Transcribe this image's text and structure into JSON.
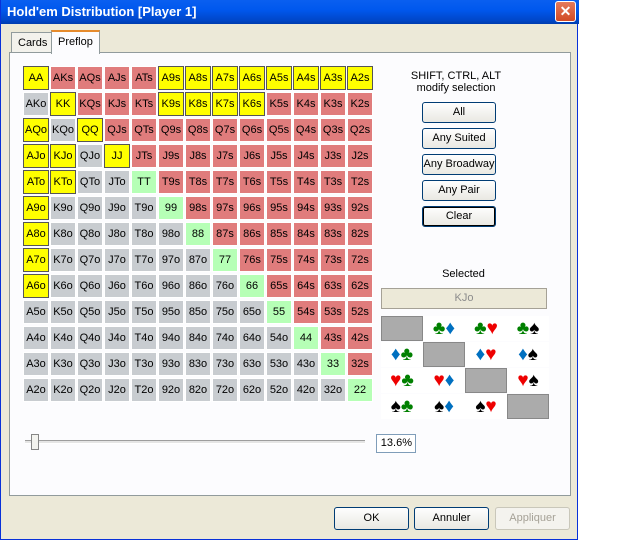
{
  "window": {
    "title": "Hold'em Distribution [Player 1]",
    "close_glyph": "✕"
  },
  "tabs": [
    {
      "label": "Cards"
    },
    {
      "label": "Preflop"
    }
  ],
  "hands": [
    [
      [
        "AA",
        "sel"
      ],
      [
        "AKs",
        "suited"
      ],
      [
        "AQs",
        "suited"
      ],
      [
        "AJs",
        "suited"
      ],
      [
        "ATs",
        "suited"
      ],
      [
        "A9s",
        "sel"
      ],
      [
        "A8s",
        "sel"
      ],
      [
        "A7s",
        "sel"
      ],
      [
        "A6s",
        "sel"
      ],
      [
        "A5s",
        "sel"
      ],
      [
        "A4s",
        "sel"
      ],
      [
        "A3s",
        "sel"
      ],
      [
        "A2s",
        "sel"
      ]
    ],
    [
      [
        "AKo",
        "offsuit"
      ],
      [
        "KK",
        "sel"
      ],
      [
        "KQs",
        "suited"
      ],
      [
        "KJs",
        "suited"
      ],
      [
        "KTs",
        "suited"
      ],
      [
        "K9s",
        "sel"
      ],
      [
        "K8s",
        "sel"
      ],
      [
        "K7s",
        "sel"
      ],
      [
        "K6s",
        "sel"
      ],
      [
        "K5s",
        "suited"
      ],
      [
        "K4s",
        "suited"
      ],
      [
        "K3s",
        "suited"
      ],
      [
        "K2s",
        "suited"
      ]
    ],
    [
      [
        "AQo",
        "sel"
      ],
      [
        "KQo",
        "offsuit"
      ],
      [
        "QQ",
        "sel"
      ],
      [
        "QJs",
        "suited"
      ],
      [
        "QTs",
        "suited"
      ],
      [
        "Q9s",
        "suited"
      ],
      [
        "Q8s",
        "suited"
      ],
      [
        "Q7s",
        "suited"
      ],
      [
        "Q6s",
        "suited"
      ],
      [
        "Q5s",
        "suited"
      ],
      [
        "Q4s",
        "suited"
      ],
      [
        "Q3s",
        "suited"
      ],
      [
        "Q2s",
        "suited"
      ]
    ],
    [
      [
        "AJo",
        "sel"
      ],
      [
        "KJo",
        "sel"
      ],
      [
        "QJo",
        "offsuit"
      ],
      [
        "JJ",
        "sel"
      ],
      [
        "JTs",
        "suited"
      ],
      [
        "J9s",
        "suited"
      ],
      [
        "J8s",
        "suited"
      ],
      [
        "J7s",
        "suited"
      ],
      [
        "J6s",
        "suited"
      ],
      [
        "J5s",
        "suited"
      ],
      [
        "J4s",
        "suited"
      ],
      [
        "J3s",
        "suited"
      ],
      [
        "J2s",
        "suited"
      ]
    ],
    [
      [
        "ATo",
        "sel"
      ],
      [
        "KTo",
        "sel"
      ],
      [
        "QTo",
        "offsuit"
      ],
      [
        "JTo",
        "offsuit"
      ],
      [
        "TT",
        "pair"
      ],
      [
        "T9s",
        "suited"
      ],
      [
        "T8s",
        "suited"
      ],
      [
        "T7s",
        "suited"
      ],
      [
        "T6s",
        "suited"
      ],
      [
        "T5s",
        "suited"
      ],
      [
        "T4s",
        "suited"
      ],
      [
        "T3s",
        "suited"
      ],
      [
        "T2s",
        "suited"
      ]
    ],
    [
      [
        "A9o",
        "sel"
      ],
      [
        "K9o",
        "offsuit"
      ],
      [
        "Q9o",
        "offsuit"
      ],
      [
        "J9o",
        "offsuit"
      ],
      [
        "T9o",
        "offsuit"
      ],
      [
        "99",
        "pair"
      ],
      [
        "98s",
        "suited"
      ],
      [
        "97s",
        "suited"
      ],
      [
        "96s",
        "suited"
      ],
      [
        "95s",
        "suited"
      ],
      [
        "94s",
        "suited"
      ],
      [
        "93s",
        "suited"
      ],
      [
        "92s",
        "suited"
      ]
    ],
    [
      [
        "A8o",
        "sel"
      ],
      [
        "K8o",
        "offsuit"
      ],
      [
        "Q8o",
        "offsuit"
      ],
      [
        "J8o",
        "offsuit"
      ],
      [
        "T8o",
        "offsuit"
      ],
      [
        "98o",
        "offsuit"
      ],
      [
        "88",
        "pair"
      ],
      [
        "87s",
        "suited"
      ],
      [
        "86s",
        "suited"
      ],
      [
        "85s",
        "suited"
      ],
      [
        "84s",
        "suited"
      ],
      [
        "83s",
        "suited"
      ],
      [
        "82s",
        "suited"
      ]
    ],
    [
      [
        "A7o",
        "sel"
      ],
      [
        "K7o",
        "offsuit"
      ],
      [
        "Q7o",
        "offsuit"
      ],
      [
        "J7o",
        "offsuit"
      ],
      [
        "T7o",
        "offsuit"
      ],
      [
        "97o",
        "offsuit"
      ],
      [
        "87o",
        "offsuit"
      ],
      [
        "77",
        "pair"
      ],
      [
        "76s",
        "suited"
      ],
      [
        "75s",
        "suited"
      ],
      [
        "74s",
        "suited"
      ],
      [
        "73s",
        "suited"
      ],
      [
        "72s",
        "suited"
      ]
    ],
    [
      [
        "A6o",
        "sel"
      ],
      [
        "K6o",
        "offsuit"
      ],
      [
        "Q6o",
        "offsuit"
      ],
      [
        "J6o",
        "offsuit"
      ],
      [
        "T6o",
        "offsuit"
      ],
      [
        "96o",
        "offsuit"
      ],
      [
        "86o",
        "offsuit"
      ],
      [
        "76o",
        "offsuit"
      ],
      [
        "66",
        "pair"
      ],
      [
        "65s",
        "suited"
      ],
      [
        "64s",
        "suited"
      ],
      [
        "63s",
        "suited"
      ],
      [
        "62s",
        "suited"
      ]
    ],
    [
      [
        "A5o",
        "offsuit"
      ],
      [
        "K5o",
        "offsuit"
      ],
      [
        "Q5o",
        "offsuit"
      ],
      [
        "J5o",
        "offsuit"
      ],
      [
        "T5o",
        "offsuit"
      ],
      [
        "95o",
        "offsuit"
      ],
      [
        "85o",
        "offsuit"
      ],
      [
        "75o",
        "offsuit"
      ],
      [
        "65o",
        "offsuit"
      ],
      [
        "55",
        "pair"
      ],
      [
        "54s",
        "suited"
      ],
      [
        "53s",
        "suited"
      ],
      [
        "52s",
        "suited"
      ]
    ],
    [
      [
        "A4o",
        "offsuit"
      ],
      [
        "K4o",
        "offsuit"
      ],
      [
        "Q4o",
        "offsuit"
      ],
      [
        "J4o",
        "offsuit"
      ],
      [
        "T4o",
        "offsuit"
      ],
      [
        "94o",
        "offsuit"
      ],
      [
        "84o",
        "offsuit"
      ],
      [
        "74o",
        "offsuit"
      ],
      [
        "64o",
        "offsuit"
      ],
      [
        "54o",
        "offsuit"
      ],
      [
        "44",
        "pair"
      ],
      [
        "43s",
        "suited"
      ],
      [
        "42s",
        "suited"
      ]
    ],
    [
      [
        "A3o",
        "offsuit"
      ],
      [
        "K3o",
        "offsuit"
      ],
      [
        "Q3o",
        "offsuit"
      ],
      [
        "J3o",
        "offsuit"
      ],
      [
        "T3o",
        "offsuit"
      ],
      [
        "93o",
        "offsuit"
      ],
      [
        "83o",
        "offsuit"
      ],
      [
        "73o",
        "offsuit"
      ],
      [
        "63o",
        "offsuit"
      ],
      [
        "53o",
        "offsuit"
      ],
      [
        "43o",
        "offsuit"
      ],
      [
        "33",
        "pair"
      ],
      [
        "32s",
        "suited"
      ]
    ],
    [
      [
        "A2o",
        "offsuit"
      ],
      [
        "K2o",
        "offsuit"
      ],
      [
        "Q2o",
        "offsuit"
      ],
      [
        "J2o",
        "offsuit"
      ],
      [
        "T2o",
        "offsuit"
      ],
      [
        "92o",
        "offsuit"
      ],
      [
        "82o",
        "offsuit"
      ],
      [
        "72o",
        "offsuit"
      ],
      [
        "62o",
        "offsuit"
      ],
      [
        "52o",
        "offsuit"
      ],
      [
        "42o",
        "offsuit"
      ],
      [
        "32o",
        "offsuit"
      ],
      [
        "22",
        "pair"
      ]
    ]
  ],
  "side": {
    "hint_line1": "SHIFT, CTRL, ALT",
    "hint_line2": "modify selection",
    "buttons": [
      "All",
      "Any Suited",
      "Any Broadway",
      "Any Pair",
      "Clear"
    ],
    "selected_label": "Selected",
    "selected_value": "KJo"
  },
  "combos": [
    [
      [],
      [
        "c",
        "d"
      ],
      [
        "c",
        "h"
      ],
      [
        "c",
        "s"
      ]
    ],
    [
      [
        "d",
        "c"
      ],
      [],
      [
        "d",
        "h"
      ],
      [
        "d",
        "s"
      ]
    ],
    [
      [
        "h",
        "c"
      ],
      [
        "h",
        "d"
      ],
      [],
      [
        "h",
        "s"
      ]
    ],
    [
      [
        "s",
        "c"
      ],
      [
        "s",
        "d"
      ],
      [
        "s",
        "h"
      ],
      []
    ]
  ],
  "suit_glyphs": {
    "c": "♣",
    "d": "♦",
    "h": "♥",
    "s": "♠"
  },
  "slider": {
    "fraction": 0.136,
    "percent_text": "13.6%"
  },
  "footer": {
    "ok": "OK",
    "cancel": "Annuler",
    "apply": "Appliquer"
  },
  "colors": {
    "selected": "#ffff00",
    "suited": "#e07c7c",
    "offsuit": "#c8ccd0",
    "pair": "#b6ffb6"
  }
}
